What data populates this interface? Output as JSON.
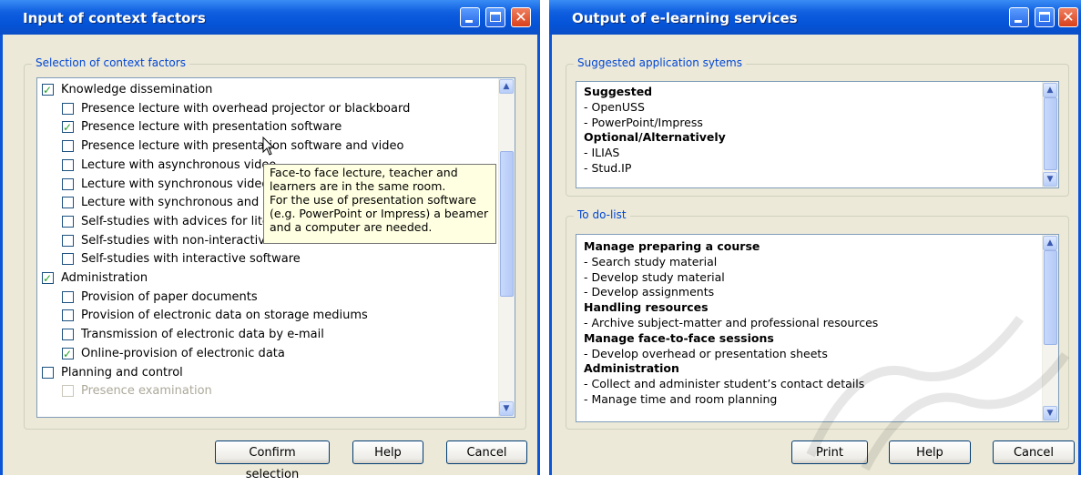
{
  "left_window": {
    "title": "Input of context factors",
    "group_label": "Selection of context factors",
    "items": [
      {
        "label": "Knowledge dissemination",
        "checked": true,
        "level": 0
      },
      {
        "label": "Presence lecture with overhead projector or blackboard",
        "checked": false,
        "level": 1
      },
      {
        "label": "Presence lecture with presentation software",
        "checked": true,
        "level": 1
      },
      {
        "label": "Presence lecture with presentation software and video",
        "checked": false,
        "level": 1
      },
      {
        "label": "Lecture with asynchronous video",
        "checked": false,
        "level": 1
      },
      {
        "label": "Lecture with synchronous video t",
        "checked": false,
        "level": 1
      },
      {
        "label": "Lecture with synchronous and in",
        "checked": false,
        "level": 1
      },
      {
        "label": "Self-studies with advices for liter",
        "checked": false,
        "level": 1
      },
      {
        "label": "Self-studies with non-interactive software",
        "checked": false,
        "level": 1
      },
      {
        "label": "Self-studies with interactive software",
        "checked": false,
        "level": 1
      },
      {
        "label": "Administration",
        "checked": true,
        "level": 0
      },
      {
        "label": "Provision of paper documents",
        "checked": false,
        "level": 1
      },
      {
        "label": "Provision of electronic data on storage mediums",
        "checked": false,
        "level": 1
      },
      {
        "label": "Transmission of electronic data by e-mail",
        "checked": false,
        "level": 1
      },
      {
        "label": "Online-provision of electronic data",
        "checked": true,
        "level": 1
      },
      {
        "label": "Planning and control",
        "checked": false,
        "level": 0
      },
      {
        "label": "Presence examination",
        "checked": false,
        "level": 1,
        "disabled": true
      }
    ],
    "tooltip": [
      "Face-to face lecture, teacher and",
      "learners are in the same room.",
      "For the use of presentation software",
      "(e.g. PowerPoint or Impress) a beamer",
      "and a computer are needed."
    ],
    "buttons": {
      "confirm": "Confirm selection",
      "help": "Help",
      "cancel": "Cancel"
    }
  },
  "right_window": {
    "title": "Output of e-learning services",
    "suggested_group_label": "Suggested application sytems",
    "suggested_lines": [
      {
        "text": "Suggested",
        "bold": true
      },
      {
        "text": "- OpenUSS",
        "bold": false
      },
      {
        "text": "- PowerPoint/Impress",
        "bold": false
      },
      {
        "text": "Optional/Alternatively",
        "bold": true
      },
      {
        "text": "- ILIAS",
        "bold": false
      },
      {
        "text": "- Stud.IP",
        "bold": false
      }
    ],
    "todo_group_label": "To do-list",
    "todo_lines": [
      {
        "text": "Manage preparing a course",
        "bold": true
      },
      {
        "text": "- Search study material",
        "bold": false
      },
      {
        "text": "- Develop study material",
        "bold": false
      },
      {
        "text": "- Develop assignments",
        "bold": false
      },
      {
        "text": "Handling resources",
        "bold": true
      },
      {
        "text": "- Archive subject-matter and professional resources",
        "bold": false
      },
      {
        "text": "Manage face-to-face sessions",
        "bold": true
      },
      {
        "text": "- Develop overhead or presentation sheets",
        "bold": false
      },
      {
        "text": "Administration",
        "bold": true
      },
      {
        "text": "- Collect and administer student’s contact details",
        "bold": false
      },
      {
        "text": "- Manage time and room planning",
        "bold": false
      }
    ],
    "buttons": {
      "print": "Print",
      "help": "Help",
      "cancel": "Cancel"
    }
  },
  "icons": {
    "minimize": "minimize-icon",
    "maximize": "maximize-icon",
    "close": "close-icon",
    "scroll_up": "scroll-up-arrow-icon",
    "scroll_down": "scroll-down-arrow-icon",
    "cursor": "mouse-pointer-icon"
  },
  "colors": {
    "titlebar": "#0553d8",
    "dialog_bg": "#ece9d8",
    "group_label": "#0046d5",
    "tooltip_bg": "#ffffe1",
    "check": "#21a121"
  }
}
